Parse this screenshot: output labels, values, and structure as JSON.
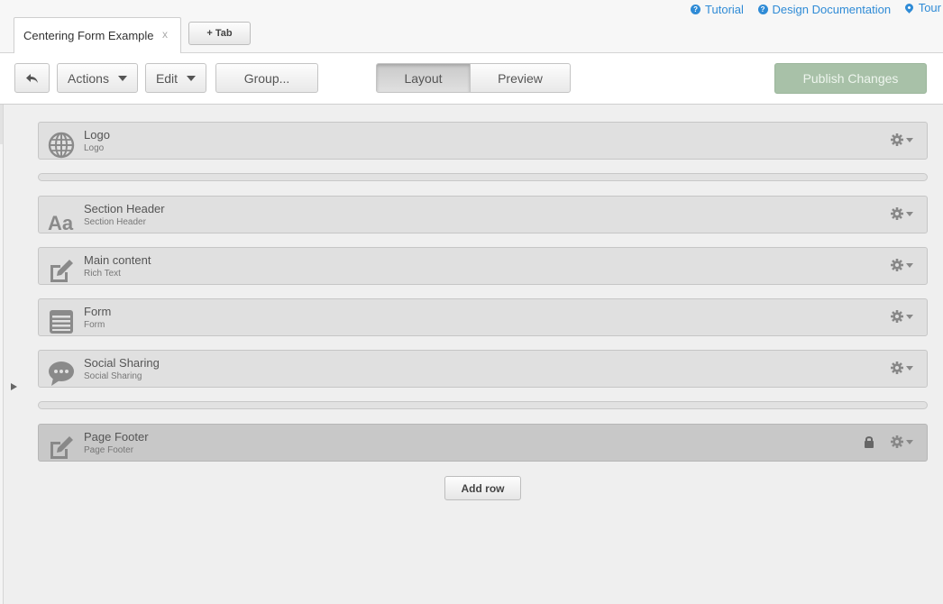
{
  "help_links": {
    "tutorial": "Tutorial",
    "design_docs": "Design Documentation",
    "tour": "Tour"
  },
  "tabs": {
    "active_label": "Centering Form Example",
    "close_glyph": "x",
    "add_tab_label": "+ Tab"
  },
  "toolbar": {
    "actions_label": "Actions",
    "edit_label": "Edit",
    "group_label": "Group...",
    "layout_label": "Layout",
    "preview_label": "Preview",
    "publish_label": "Publish Changes",
    "active_view": "Layout"
  },
  "modules": [
    {
      "title": "Logo",
      "subtitle": "Logo",
      "icon": "globe-icon",
      "locked": false
    },
    {
      "title": "Section Header",
      "subtitle": "Section Header",
      "icon": "text-aa-icon",
      "locked": false
    },
    {
      "title": "Main content",
      "subtitle": "Rich Text",
      "icon": "edit-pencil-icon",
      "locked": false
    },
    {
      "title": "Form",
      "subtitle": "Form",
      "icon": "form-list-icon",
      "locked": false
    },
    {
      "title": "Social Sharing",
      "subtitle": "Social Sharing",
      "icon": "speech-bubble-icon",
      "locked": false
    },
    {
      "title": "Page Footer",
      "subtitle": "Page Footer",
      "icon": "edit-pencil-icon",
      "locked": true
    }
  ],
  "add_row_label": "Add row",
  "colors": {
    "link": "#2f8bd6",
    "publish_bg": "#a8c1a8",
    "module_bg": "#e0e0e0",
    "locked_bg": "#c8c8c8"
  }
}
